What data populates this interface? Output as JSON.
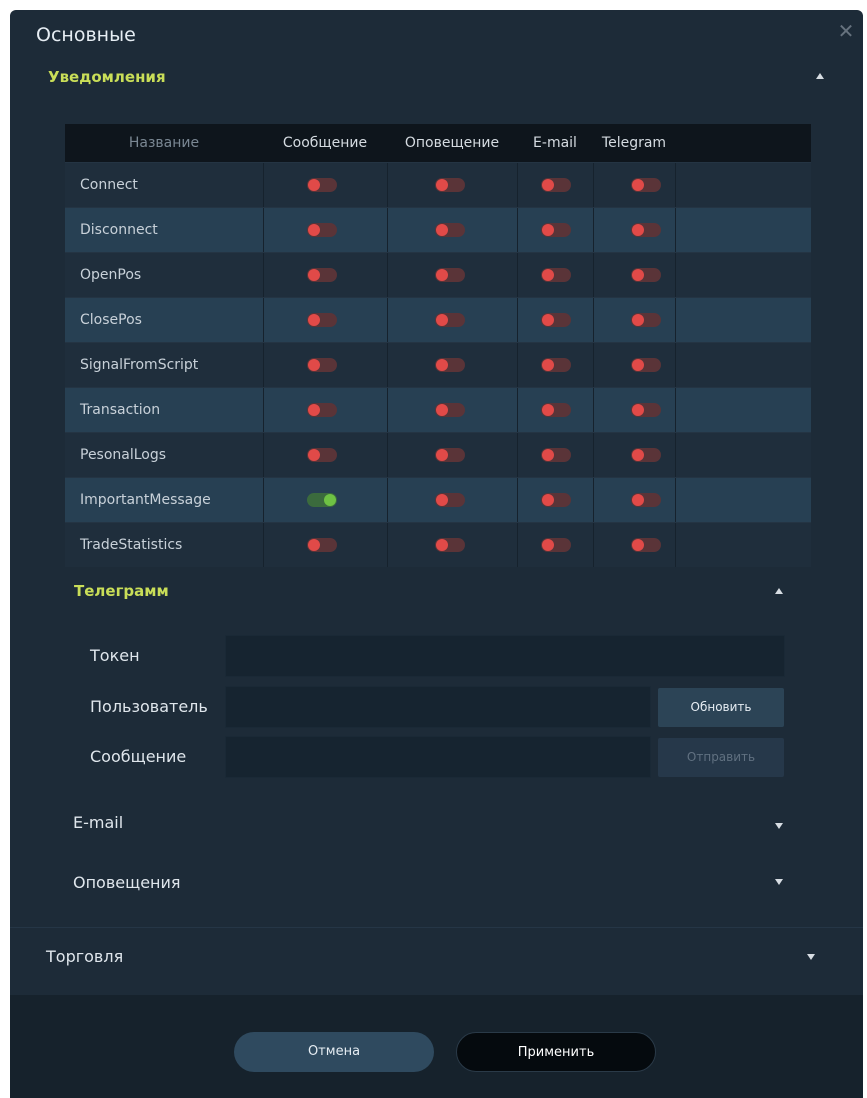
{
  "window": {
    "title": "Основные",
    "close_glyph": "✕"
  },
  "notifications": {
    "title": "Уведомления",
    "columns": [
      "Название",
      "Сообщение",
      "Оповещение",
      "E-mail",
      "Telegram"
    ],
    "rows": [
      {
        "name": "Connect",
        "message": false,
        "alert": false,
        "email": false,
        "telegram": false
      },
      {
        "name": "Disconnect",
        "message": false,
        "alert": false,
        "email": false,
        "telegram": false
      },
      {
        "name": "OpenPos",
        "message": false,
        "alert": false,
        "email": false,
        "telegram": false
      },
      {
        "name": "ClosePos",
        "message": false,
        "alert": false,
        "email": false,
        "telegram": false
      },
      {
        "name": "SignalFromScript",
        "message": false,
        "alert": false,
        "email": false,
        "telegram": false
      },
      {
        "name": "Transaction",
        "message": false,
        "alert": false,
        "email": false,
        "telegram": false
      },
      {
        "name": "PesonalLogs",
        "message": false,
        "alert": false,
        "email": false,
        "telegram": false
      },
      {
        "name": "ImportantMessage",
        "message": true,
        "alert": false,
        "email": false,
        "telegram": false
      },
      {
        "name": "TradeStatistics",
        "message": false,
        "alert": false,
        "email": false,
        "telegram": false
      }
    ]
  },
  "telegram": {
    "title": "Телеграмм",
    "token_label": "Токен",
    "token_value": "",
    "user_label": "Пользователь",
    "user_value": "",
    "message_label": "Сообщение",
    "message_value": "",
    "update_button": "Обновить",
    "send_button": "Отправить"
  },
  "email_section": {
    "title": "E-mail"
  },
  "alerts_section": {
    "title": "Оповещения"
  },
  "trading_section": {
    "title": "Торговля"
  },
  "footer": {
    "cancel": "Отмена",
    "apply": "Применить"
  },
  "colors": {
    "accent_title": "#c9de58",
    "toggle_off": "#e14a48",
    "toggle_on": "#6ec244",
    "background": "#1d2b38"
  },
  "icons": {
    "close": "close-icon",
    "collapse": "caret-up-icon",
    "expand": "caret-down-icon"
  }
}
